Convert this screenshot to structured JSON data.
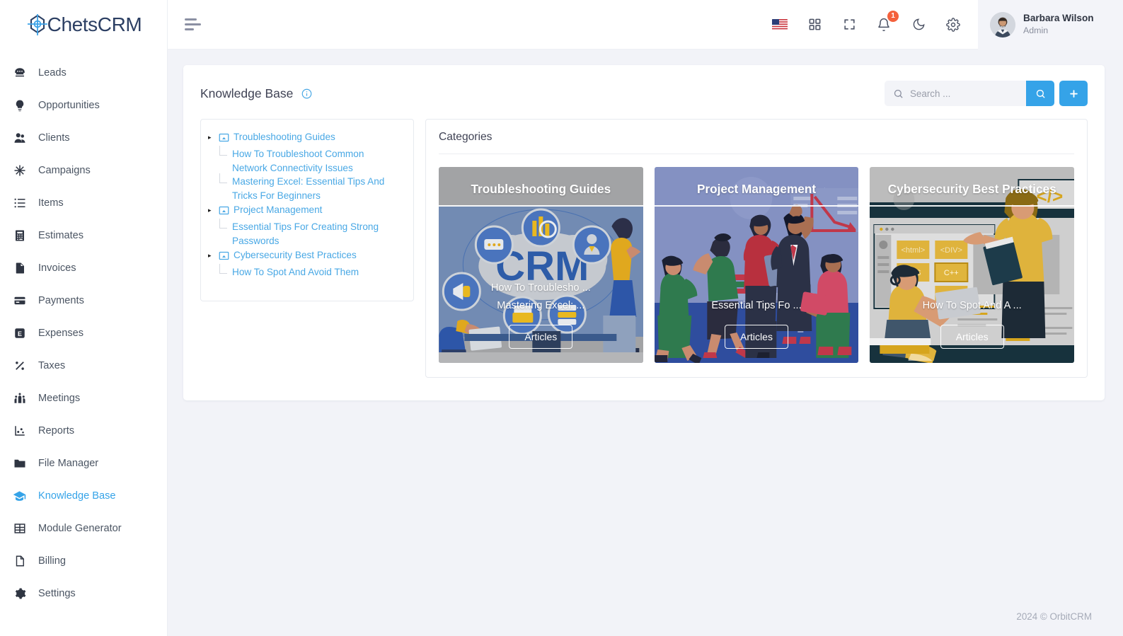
{
  "brand": {
    "name": "ChetsCRM",
    "logo_icon": "target-crosshair-icon",
    "color": "#35a3e8"
  },
  "sidebar": {
    "items": [
      {
        "label": "Leads",
        "icon": "phone-rotary-icon",
        "active": false
      },
      {
        "label": "Opportunities",
        "icon": "lightbulb-icon",
        "active": false
      },
      {
        "label": "Clients",
        "icon": "user-group-icon",
        "active": false
      },
      {
        "label": "Campaigns",
        "icon": "snowflake-network-icon",
        "active": false
      },
      {
        "label": "Items",
        "icon": "list-icon",
        "active": false
      },
      {
        "label": "Estimates",
        "icon": "calculator-icon",
        "active": false
      },
      {
        "label": "Invoices",
        "icon": "document-icon",
        "active": false
      },
      {
        "label": "Payments",
        "icon": "credit-card-icon",
        "active": false
      },
      {
        "label": "Expenses",
        "icon": "expense-e-icon",
        "active": false
      },
      {
        "label": "Taxes",
        "icon": "percent-icon",
        "active": false
      },
      {
        "label": "Meetings",
        "icon": "people-meeting-icon",
        "active": false
      },
      {
        "label": "Reports",
        "icon": "chart-scatter-icon",
        "active": false
      },
      {
        "label": "File Manager",
        "icon": "folder-icon",
        "active": false
      },
      {
        "label": "Knowledge Base",
        "icon": "graduation-cap-icon",
        "active": true
      },
      {
        "label": "Module Generator",
        "icon": "grid-table-icon",
        "active": false
      },
      {
        "label": "Billing",
        "icon": "page-icon",
        "active": false
      },
      {
        "label": "Settings",
        "icon": "gear-icon",
        "active": false
      }
    ]
  },
  "topbar": {
    "menu_toggle_icon": "hamburger-icon",
    "icons": [
      {
        "name": "language-flag-us-icon",
        "label": ""
      },
      {
        "name": "apps-grid-icon",
        "label": ""
      },
      {
        "name": "fullscreen-icon",
        "label": ""
      },
      {
        "name": "notification-bell-icon",
        "label": ""
      },
      {
        "name": "dark-mode-moon-icon",
        "label": ""
      },
      {
        "name": "settings-gear-icon",
        "label": ""
      }
    ],
    "notification_count": "1",
    "user": {
      "name": "Barbara Wilson",
      "role": "Admin",
      "avatar": "user-avatar"
    }
  },
  "page": {
    "title": "Knowledge Base",
    "info_icon": "info-circle-icon",
    "search": {
      "placeholder": "Search ...",
      "value": ""
    },
    "search_button_icon": "search-icon",
    "add_button_icon": "plus-icon"
  },
  "tree": {
    "nodes": [
      {
        "label": "Troubleshooting Guides",
        "icon": "category-window-icon",
        "caret": "▸",
        "children": [
          "How To Troubleshoot Common Network Connectivity Issues",
          "Mastering Excel: Essential Tips And Tricks For Beginners"
        ]
      },
      {
        "label": "Project Management",
        "icon": "category-window-icon",
        "caret": "▸",
        "children": [
          "Essential Tips For Creating Strong Passwords"
        ]
      },
      {
        "label": "Cybersecurity Best Practices",
        "icon": "category-window-icon",
        "caret": "▸",
        "children": [
          "How To Spot And Avoid Them"
        ]
      }
    ]
  },
  "categories": {
    "heading": "Categories",
    "cards": [
      {
        "title": "Troubleshooting Guides",
        "articles": [
          "How To Troublesho ...",
          "Mastering Excel: ..."
        ],
        "button": "Articles",
        "art": "crm-cloud-illustration",
        "bg": "#9a9a9a"
      },
      {
        "title": "Project Management",
        "articles": [
          "Essential Tips Fo ..."
        ],
        "button": "Articles",
        "art": "team-meeting-illustration",
        "bg": "#8490c0"
      },
      {
        "title": "Cybersecurity Best Practices",
        "articles": [
          "How To Spot And A ..."
        ],
        "button": "Articles",
        "art": "coding-workshop-illustration",
        "bg": "#b9b9b9"
      }
    ]
  },
  "footer": {
    "text": "2024 © OrbitCRM"
  }
}
